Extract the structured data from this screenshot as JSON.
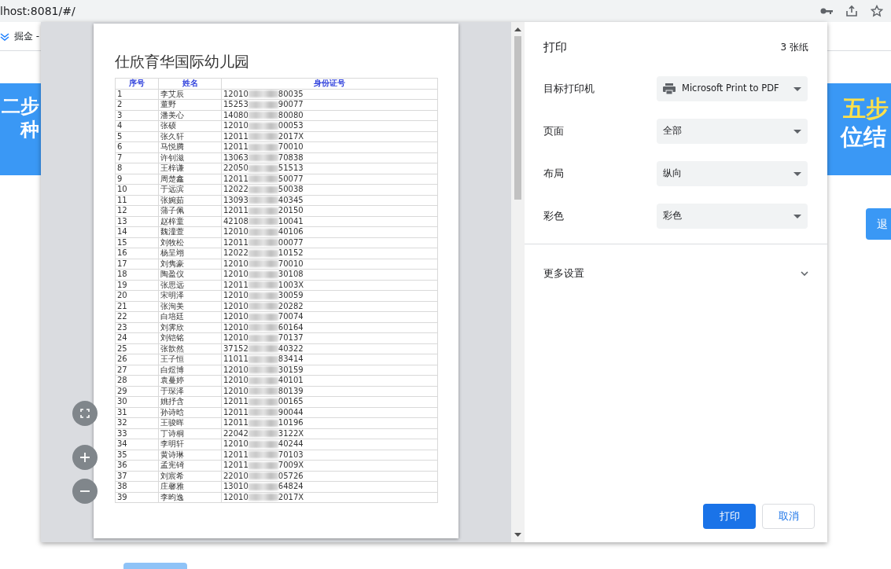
{
  "browser": {
    "address": "lhost:8081/#/",
    "bookmark": "掘金 -"
  },
  "background_page": {
    "left_banner": [
      "二步",
      "种"
    ],
    "right_banner": [
      "五步",
      "位结"
    ],
    "right_button": "退"
  },
  "preview": {
    "title": "仕欣育华国际幼儿园",
    "table": {
      "columns": [
        "序号",
        "姓名",
        "身份证号"
      ],
      "rows": [
        [
          "1",
          "李艾辰",
          "12010",
          "80035"
        ],
        [
          "2",
          "董野",
          "15253",
          "90077"
        ],
        [
          "3",
          "潘美心",
          "14080",
          "80080"
        ],
        [
          "4",
          "张硕",
          "12010",
          "00053"
        ],
        [
          "5",
          "张久轩",
          "12011",
          "2017X"
        ],
        [
          "6",
          "马悦腾",
          "12011",
          "70010"
        ],
        [
          "7",
          "许钊滋",
          "13063",
          "70838"
        ],
        [
          "8",
          "王梓谦",
          "22050",
          "51513"
        ],
        [
          "9",
          "周楚鑫",
          "12011",
          "50077"
        ],
        [
          "10",
          "于远滨",
          "12022",
          "50038"
        ],
        [
          "11",
          "张婉茹",
          "13093",
          "40345"
        ],
        [
          "12",
          "蒲子佩",
          "12011",
          "20150"
        ],
        [
          "13",
          "赵梓童",
          "42108",
          "10041"
        ],
        [
          "14",
          "魏潼萱",
          "12010",
          "40106"
        ],
        [
          "15",
          "刘牧松",
          "12011",
          "00077"
        ],
        [
          "16",
          "杨呈翊",
          "12022",
          "10152"
        ],
        [
          "17",
          "刘隽豪",
          "12010",
          "70010"
        ],
        [
          "18",
          "陶盈仪",
          "12010",
          "30108"
        ],
        [
          "19",
          "张思远",
          "12011",
          "1003X"
        ],
        [
          "20",
          "宋明泽",
          "12010",
          "30059"
        ],
        [
          "21",
          "张洵美",
          "12010",
          "20282"
        ],
        [
          "22",
          "白培廷",
          "12010",
          "70074"
        ],
        [
          "23",
          "刘霁欣",
          "12010",
          "60164"
        ],
        [
          "24",
          "刘铠铭",
          "12010",
          "70137"
        ],
        [
          "25",
          "张歆然",
          "37152",
          "40322"
        ],
        [
          "26",
          "王子恒",
          "11011",
          "83414"
        ],
        [
          "27",
          "白煜博",
          "12010",
          "30159"
        ],
        [
          "28",
          "袁蔓婷",
          "12010",
          "40101"
        ],
        [
          "29",
          "于琛泽",
          "12010",
          "80139"
        ],
        [
          "30",
          "姚抒含",
          "12011",
          "00165"
        ],
        [
          "31",
          "孙诗晗",
          "12011",
          "90044"
        ],
        [
          "32",
          "王骏晖",
          "12011",
          "10196"
        ],
        [
          "33",
          "丁诗桐",
          "22042",
          "3122X"
        ],
        [
          "34",
          "李明轩",
          "12010",
          "40244"
        ],
        [
          "35",
          "黄诗琳",
          "12011",
          "70103"
        ],
        [
          "36",
          "孟宪锜",
          "12011",
          "7009X"
        ],
        [
          "37",
          "刘宸希",
          "22010",
          "05726"
        ],
        [
          "38",
          "庄馨雅",
          "13010",
          "64824"
        ],
        [
          "39",
          "李昀逸",
          "12010",
          "2017X"
        ]
      ]
    }
  },
  "panel": {
    "title": "打印",
    "sheets": "3 张纸",
    "settings": [
      {
        "label": "目标打印机",
        "value": "Microsoft Print to PDF",
        "kind": "printer"
      },
      {
        "label": "页面",
        "value": "全部",
        "kind": "plain"
      },
      {
        "label": "布局",
        "value": "纵向",
        "kind": "plain"
      },
      {
        "label": "彩色",
        "value": "彩色",
        "kind": "plain"
      }
    ],
    "more_settings": {
      "label": "更多设置",
      "expanded": false
    },
    "buttons": [
      {
        "label": "打印",
        "kind": "primary"
      },
      {
        "label": "取消",
        "kind": "secondary"
      }
    ]
  }
}
